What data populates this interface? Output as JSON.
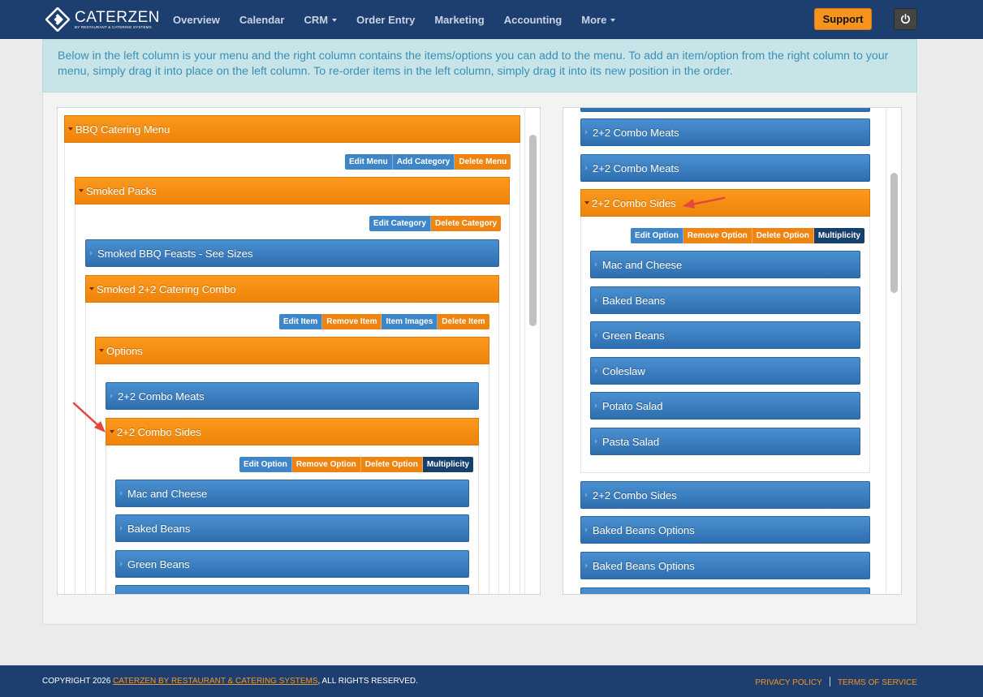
{
  "brand": {
    "name": "CATERZEN",
    "tagline": "BY RESTAURANT & CATERING SYSTEMS"
  },
  "nav": {
    "items": [
      "Overview",
      "Calendar",
      "CRM",
      "Order Entry",
      "Marketing",
      "Accounting",
      "More"
    ],
    "support_label": "Support"
  },
  "info_text": "Below in the left column is your menu and the right column contains the items/options you can add to the menu. To add an item/option from the right column to your menu, simply drag it into place on the left column. To re-order items in the left column, simply drag it into its new position in the order.",
  "left": {
    "menu_title": "BBQ Catering Menu",
    "menu_buttons": [
      "Edit Menu",
      "Add Category",
      "Delete Menu"
    ],
    "category_title": "Smoked Packs",
    "category_buttons": [
      "Edit Category",
      "Delete Category"
    ],
    "item1": "Smoked BBQ Feasts - See Sizes",
    "item2": "Smoked 2+2 Catering Combo",
    "item_buttons": [
      "Edit Item",
      "Remove Item",
      "Item Images",
      "Delete Item"
    ],
    "options_title": "Options",
    "option1": "2+2 Combo Meats",
    "option2": "2+2 Combo Sides",
    "option_buttons": [
      "Edit Option",
      "Remove Option",
      "Delete Option",
      "Multiplicity"
    ],
    "choices": [
      "Mac and Cheese",
      "Baked Beans",
      "Green Beans"
    ]
  },
  "right": {
    "items_top": [
      "2+2 Combo Meats",
      "2+2 Combo Meats"
    ],
    "expanded_title": "2+2 Combo Sides",
    "option_buttons": [
      "Edit Option",
      "Remove Option",
      "Delete Option",
      "Multiplicity"
    ],
    "choices": [
      "Mac and Cheese",
      "Baked Beans",
      "Green Beans",
      "Coleslaw",
      "Potato Salad",
      "Pasta Salad"
    ],
    "items_bottom": [
      "2+2 Combo Sides",
      "Baked Beans Options",
      "Baked Beans Options"
    ]
  },
  "footer": {
    "copyright_prefix": "COPYRIGHT 2026 ",
    "company_link": "CATERZEN BY RESTAURANT & CATERING SYSTEMS",
    "copyright_suffix": ", ALL RIGHTS RESERVED.",
    "privacy": "PRIVACY POLICY",
    "terms": "TERMS OF SERVICE"
  },
  "colors": {
    "nav_bg": "#1d3f6f",
    "orange": "#ef8510",
    "blue": "#3f86c9",
    "navy": "#173f6c",
    "info_bg": "#c7e5e8",
    "arrow": "#e4473d"
  }
}
